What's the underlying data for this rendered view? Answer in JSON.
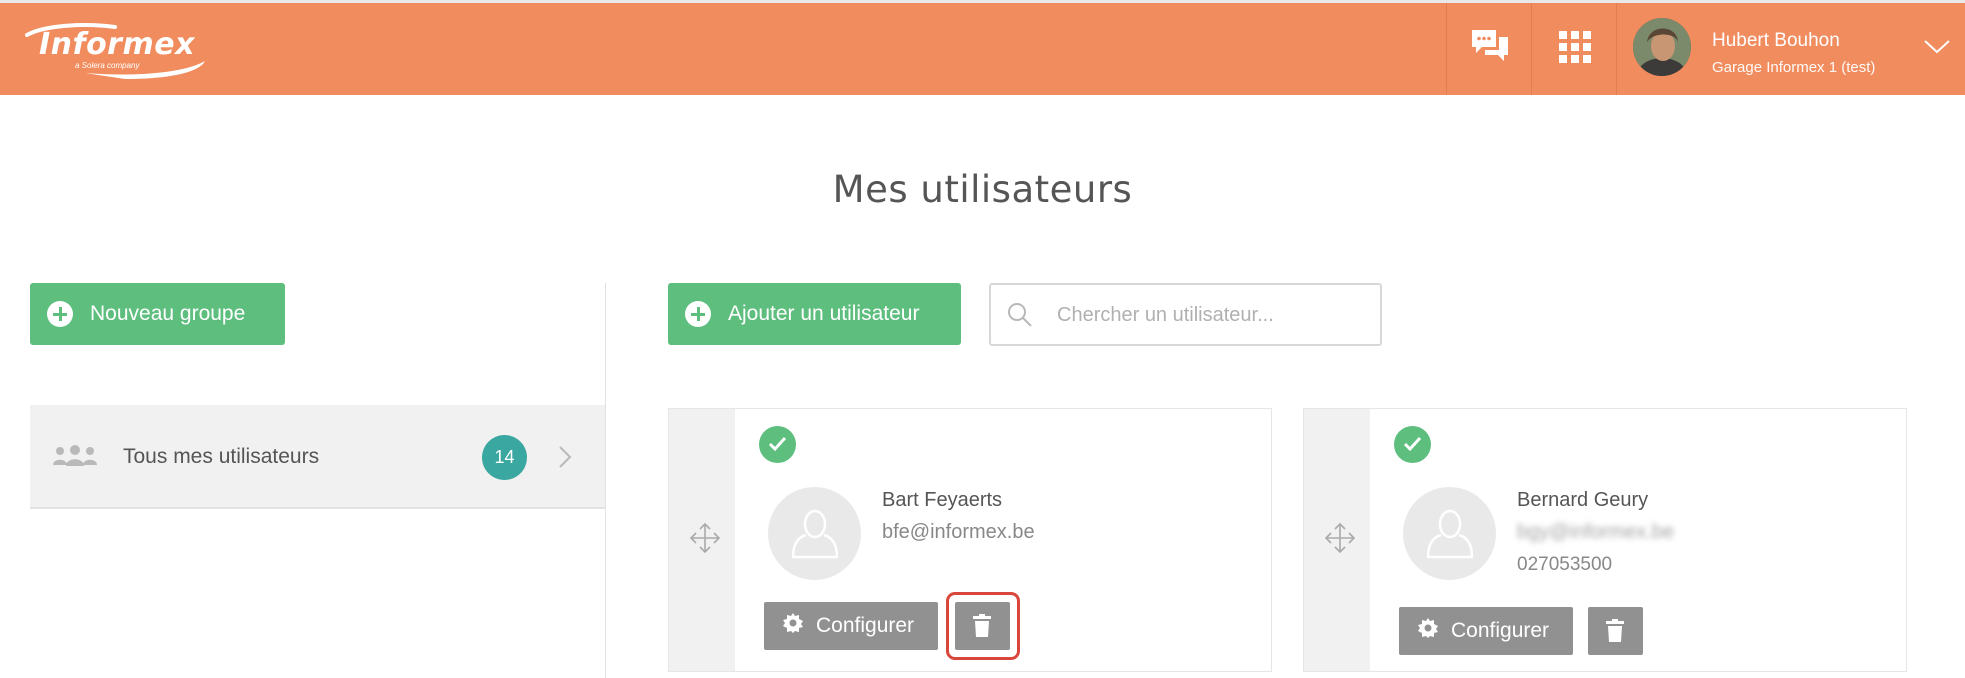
{
  "header": {
    "logo": {
      "wordmark": "Informex",
      "tagline": "a Solera company"
    },
    "user": {
      "name": "Hubert Bouhon",
      "organization": "Garage Informex 1 (test)"
    },
    "colors": {
      "bar": "#f18c5e"
    }
  },
  "page": {
    "title": "Mes utilisateurs"
  },
  "sidebar": {
    "new_group_label": "Nouveau groupe",
    "groups": [
      {
        "label": "Tous mes utilisateurs",
        "count": "14"
      }
    ]
  },
  "toolbar": {
    "add_user_label": "Ajouter un utilisateur",
    "search_placeholder": "Chercher un utilisateur..."
  },
  "users": [
    {
      "name": "Bart Feyaerts",
      "email": "bfe@informex.be",
      "phone": "",
      "configure_label": "Configurer",
      "active": true
    },
    {
      "name": "Bernard Geury",
      "email": "bgy@informex.be",
      "phone": "027053500",
      "configure_label": "Configurer",
      "active": true
    }
  ],
  "colors": {
    "accent_green": "#5dbe7e",
    "badge_teal": "#3aa7a0",
    "button_gray": "#919191",
    "highlight_red": "#d9463b"
  }
}
